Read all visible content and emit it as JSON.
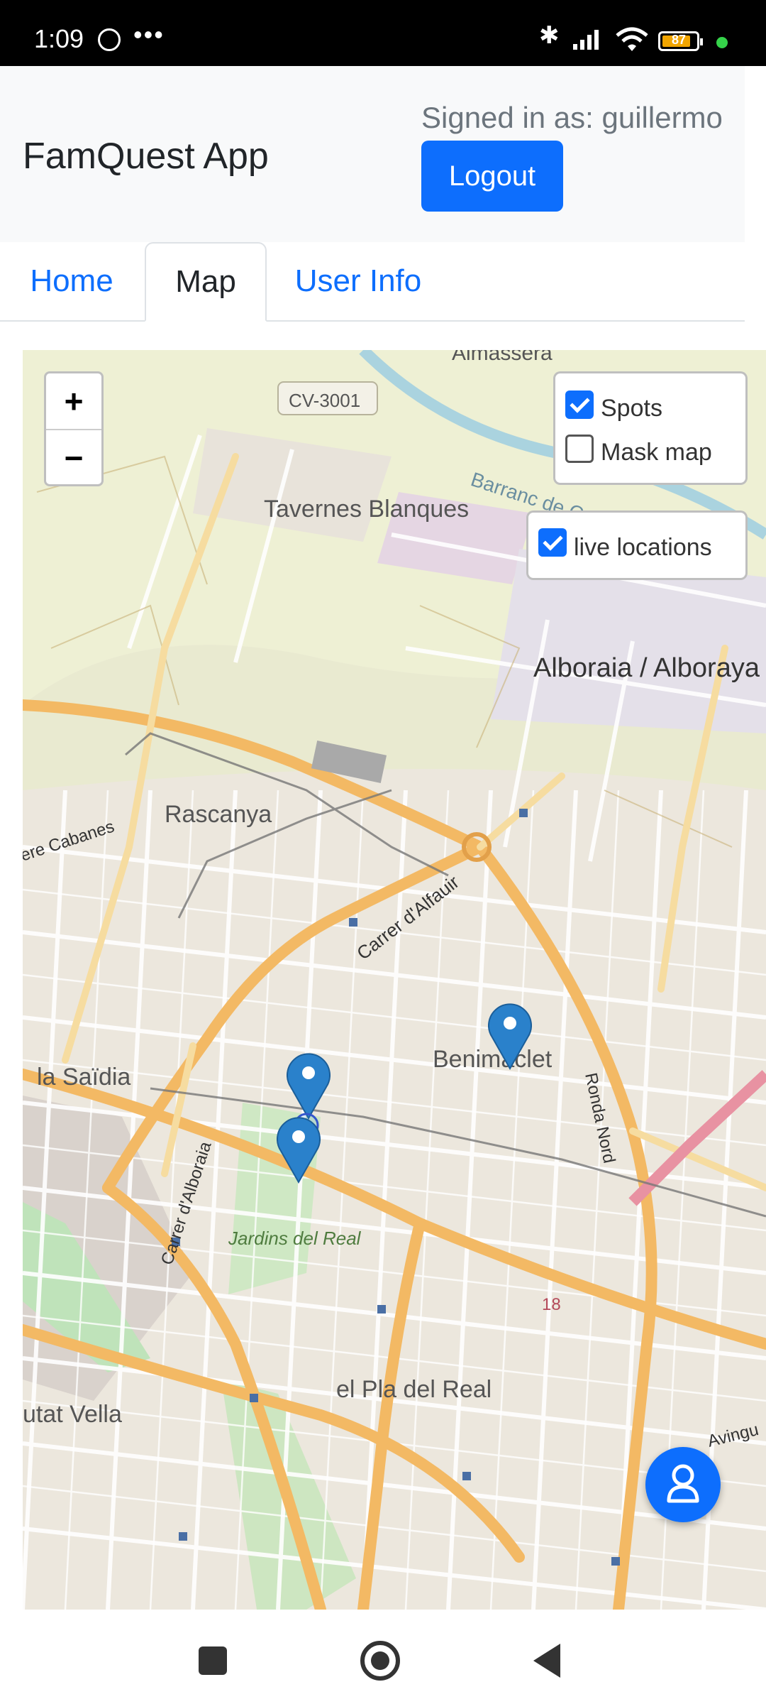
{
  "status_bar": {
    "time": "1:09",
    "overflow_dots": "•••",
    "battery_level": "87",
    "battery_fraction": 0.87
  },
  "header": {
    "brand": "FamQuest App",
    "signed_in": "Signed in as: guillermo",
    "logout_label": "Logout"
  },
  "tabs": [
    {
      "label": "Home",
      "active": false
    },
    {
      "label": "Map",
      "active": true
    },
    {
      "label": "User Info",
      "active": false
    }
  ],
  "map": {
    "zoom_in": "+",
    "zoom_out": "−",
    "layers": {
      "spots_label": "Spots",
      "spots_checked": true,
      "mask_label": "Mask map",
      "mask_checked": false
    },
    "live": {
      "label": "live locations",
      "checked": true
    },
    "place_labels": {
      "almassera": "Almassera",
      "cv3001": "CV-3001",
      "tavernes": "Tavernes Blanques",
      "barranc": "Barranc de Carraixet",
      "alboraia": "Alboraia / Alboraya",
      "rascanya": "Rascanya",
      "cabanes": "ere Cabanes",
      "alfauir": "Carrer d'Alfauir",
      "benimaclet": "Benimaclet",
      "ronda": "Ronda Nord",
      "saidia": "la Saïdia",
      "alboraia_st": "Carrer d'Alboraia",
      "jardins": "Jardins del Real",
      "num18": "18",
      "pla": "el Pla del Real",
      "ciutat": "utat Vella",
      "avinguda": "Avingu"
    }
  },
  "colors": {
    "primary": "#0d6efd",
    "marker": "#2a81cb",
    "navbar_bg": "#f8f9fa"
  },
  "icons": {
    "fab": "person-icon",
    "marker": "map-pin-icon"
  }
}
